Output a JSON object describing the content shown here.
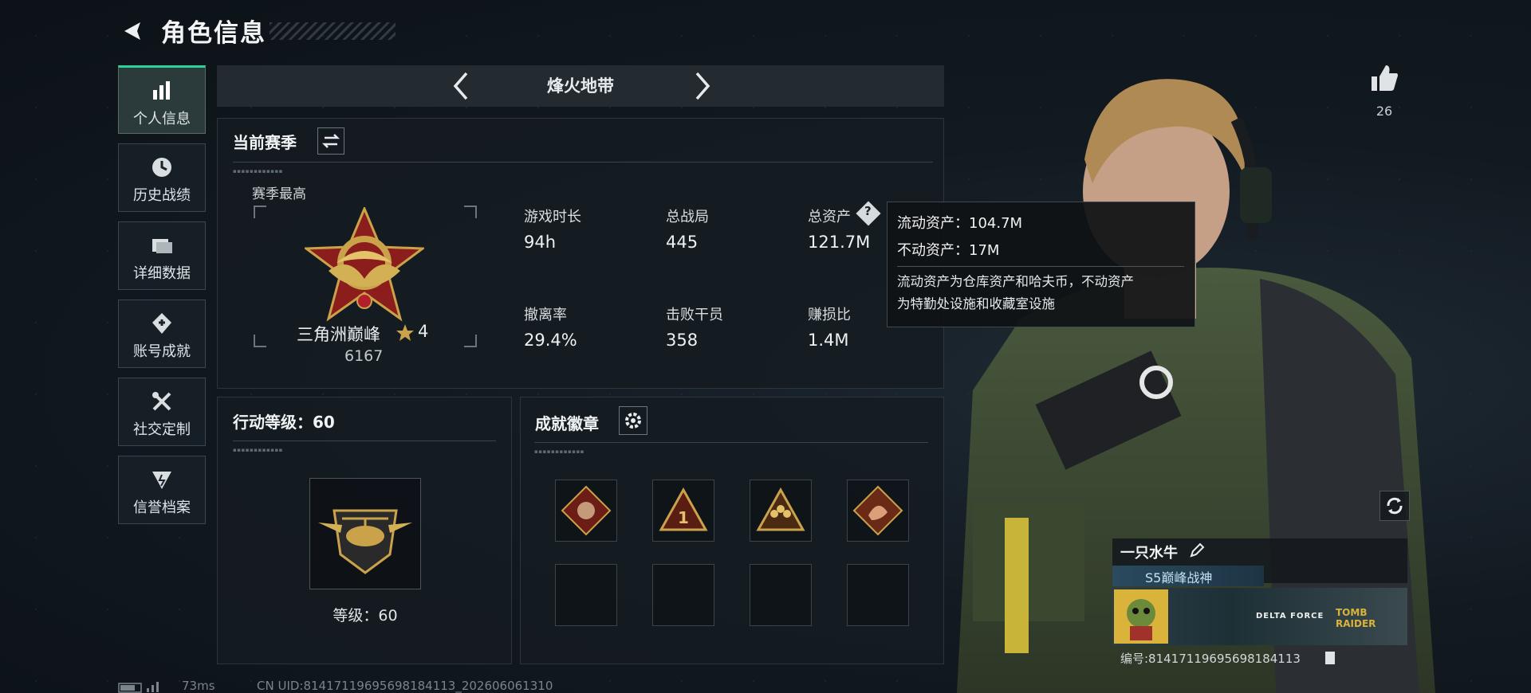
{
  "header": {
    "title": "角色信息"
  },
  "sidebar": {
    "items": [
      {
        "label": "个人信息",
        "icon": "bar-chart-icon",
        "active": true
      },
      {
        "label": "历史战绩",
        "icon": "clock-icon",
        "active": false
      },
      {
        "label": "详细数据",
        "icon": "folder-icon",
        "active": false
      },
      {
        "label": "账号成就",
        "icon": "achievement-icon",
        "active": false
      },
      {
        "label": "社交定制",
        "icon": "tools-icon",
        "active": false
      },
      {
        "label": "信誉档案",
        "icon": "shield-icon",
        "active": false
      }
    ]
  },
  "mode_tab": {
    "title": "烽火地带"
  },
  "season": {
    "title": "当前赛季",
    "highest_label": "赛季最高",
    "rank_name": "三角洲巅峰",
    "rank_stars": "4",
    "rank_score": "6167",
    "stats": [
      {
        "label": "游戏时长",
        "value": "94h"
      },
      {
        "label": "总战局",
        "value": "445"
      },
      {
        "label": "总资产",
        "value": "121.7M"
      },
      {
        "label": "撤离率",
        "value": "29.4%"
      },
      {
        "label": "击败干员",
        "value": "358"
      },
      {
        "label": "赚损比",
        "value": "1.4M"
      }
    ]
  },
  "tooltip": {
    "liquid": "流动资产：104.7M",
    "fixed": "不动资产：17M",
    "desc_line1": "流动资产为仓库资产和哈夫币，不动资产",
    "desc_line2": "为特勤处设施和收藏室设施"
  },
  "action_level": {
    "title": "行动等级：60",
    "level_text": "等级：60"
  },
  "badges": {
    "title": "成就徽章"
  },
  "likes": {
    "count": "26"
  },
  "player": {
    "name": "一只水牛",
    "title": "S5巅峰战神",
    "id_text": "编号:81417119695698184113",
    "banner_brand1": "DELTA FORCE",
    "banner_brand2": "TOMB RAIDER"
  },
  "footer": {
    "ping": "73ms",
    "uid": "CN UID:81417119695698184113_202606061310"
  },
  "colors": {
    "accent": "#2bd39a",
    "gold": "#c9a24a",
    "panel": "#141b21"
  }
}
